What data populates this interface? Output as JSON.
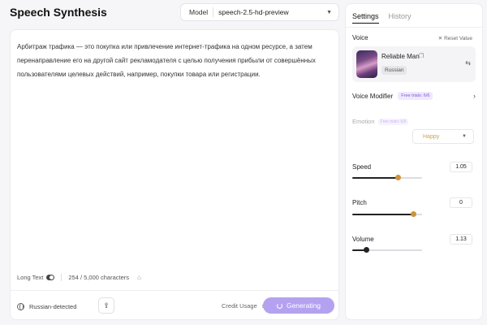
{
  "header": {
    "title": "Speech Synthesis",
    "model_label": "Model",
    "model_value": "speech-2.5-hd-preview"
  },
  "editor": {
    "text": "Арбитраж трафика — это покупка или привлечение интернет-трафика на одном ресурсе, а затем перенаправление его на другой сайт рекламодателя с целью получения прибыли от совершённых пользователями целевых действий, например, покупки товара или регистрации.",
    "long_text_label": "Long Text",
    "char_count": "254 / 5,000 characters",
    "language": "Russian-detected",
    "credit_usage_label": "Credit Usage",
    "generate_label": "Generating"
  },
  "settings": {
    "tab_settings": "Settings",
    "tab_history": "History",
    "voice_label": "Voice",
    "reset_label": "Reset Value",
    "voice_name": "Reliable Man",
    "voice_language": "Russian",
    "voice_modifier_label": "Voice Modifier",
    "free_trials": "Free trials: 6/6",
    "emotion_label": "Emotion",
    "emotion_free_trials": "Free trials: 6/6",
    "emotion_value": "Happy",
    "speed_label": "Speed",
    "speed_value": "1.05",
    "speed_level": 0.65,
    "pitch_label": "Pitch",
    "pitch_value": "0",
    "pitch_level": 0.87,
    "volume_label": "Volume",
    "volume_value": "1.13",
    "volume_level": 0.2
  },
  "icons": {
    "globe": "globe-icon",
    "upload": "upload-icon",
    "spinner": "spinner-icon",
    "copy": "copy-icon",
    "swap": "swap-icon",
    "reset": "reset-icon",
    "chevron": "chevron-right-icon"
  },
  "colors": {
    "accent": "#b4a2f0",
    "badge": "#7a5bd8",
    "thumb_orange": "#d0923c"
  }
}
